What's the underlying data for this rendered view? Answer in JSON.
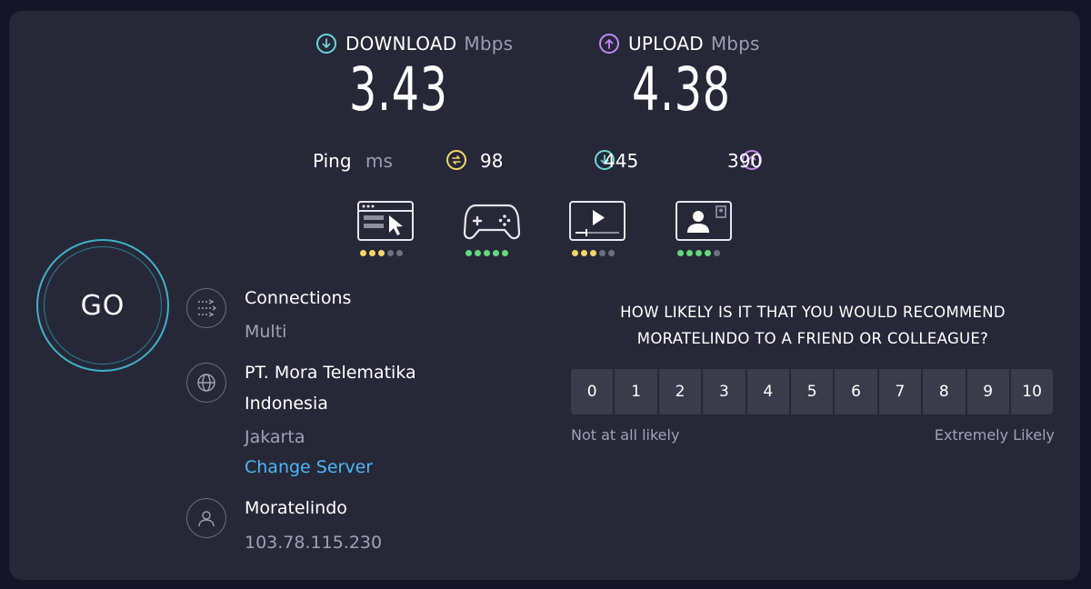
{
  "download": {
    "label": "DOWNLOAD",
    "unit": "Mbps",
    "value": "3.43",
    "color": "#6ad6d8"
  },
  "upload": {
    "label": "UPLOAD",
    "unit": "Mbps",
    "value": "4.38",
    "color": "#c187f7"
  },
  "ping": {
    "label": "Ping",
    "unit": "ms",
    "idle": "98",
    "download": "445",
    "upload": "390",
    "idle_color": "#f5d66b"
  },
  "quality": [
    {
      "icon": "web-browsing-icon",
      "rating": 3,
      "color": "#f5d66b"
    },
    {
      "icon": "gaming-controller-icon",
      "rating": 5,
      "color": "#63d97b"
    },
    {
      "icon": "video-streaming-icon",
      "rating": 3,
      "color": "#f5d66b"
    },
    {
      "icon": "video-call-icon",
      "rating": 4,
      "color": "#63d97b"
    }
  ],
  "go_label": "GO",
  "connections": {
    "title": "Connections",
    "value": "Multi"
  },
  "server": {
    "name_line1": "PT. Mora Telematika",
    "name_line2": "Indonesia",
    "location": "Jakarta",
    "change_link": "Change Server"
  },
  "isp": {
    "name": "Moratelindo",
    "ip": "103.78.115.230"
  },
  "survey": {
    "question_line1": "HOW LIKELY IS IT THAT YOU WOULD RECOMMEND",
    "question_line2": "MORATELINDO TO A FRIEND OR COLLEAGUE?",
    "scale": [
      "0",
      "1",
      "2",
      "3",
      "4",
      "5",
      "6",
      "7",
      "8",
      "9",
      "10"
    ],
    "low_label": "Not at all likely",
    "high_label": "Extremely Likely"
  }
}
